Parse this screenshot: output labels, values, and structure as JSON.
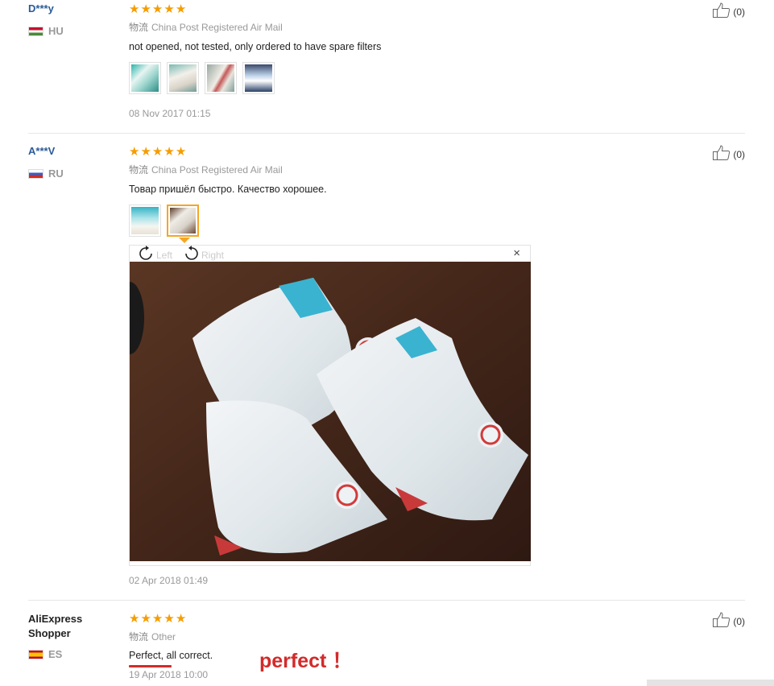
{
  "reviews": [
    {
      "user": "D***y",
      "country": "HU",
      "rating_stars": 5,
      "shipping_label": "物流",
      "shipping_method": "China Post Registered Air Mail",
      "text": "not opened, not tested, only ordered to have spare filters",
      "photo_count": 4,
      "date": "08 Nov 2017 01:15",
      "likes": "(0)"
    },
    {
      "user": "A***V",
      "country": "RU",
      "rating_stars": 5,
      "shipping_label": "物流",
      "shipping_method": "China Post Registered Air Mail",
      "text": "Товар пришёл быстро. Качество хорошее.",
      "photo_count": 2,
      "date": "02 Apr 2018 01:49",
      "likes": "(0)",
      "viewer": {
        "rotate_left": "Left",
        "rotate_right": "Right",
        "close": "×"
      }
    },
    {
      "user": "AliExpress Shopper",
      "country": "ES",
      "rating_stars": 5,
      "shipping_label": "物流",
      "shipping_method": "Other",
      "text": "Perfect, all correct.",
      "date": "19 Apr 2018 10:00",
      "likes": "(0)"
    }
  ],
  "annotation": "perfect ！",
  "star_glyph": "★",
  "colors": {
    "star": "#f59d00",
    "username": "#2a5b98",
    "annotation": "#d42a2a",
    "active_thumb_border": "#f5a623"
  }
}
